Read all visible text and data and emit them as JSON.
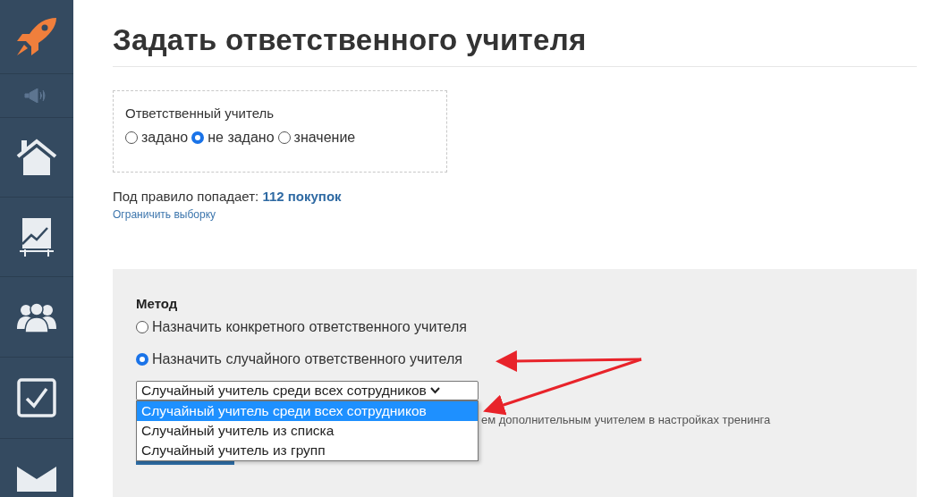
{
  "title": "Задать ответственного учителя",
  "filter": {
    "label": "Ответственный учитель",
    "options": [
      {
        "label": "задано",
        "selected": false
      },
      {
        "label": "не задано",
        "selected": true
      },
      {
        "label": "значение",
        "selected": false
      }
    ]
  },
  "match": {
    "prefix": "Под правило попадает:",
    "count": "112 покупок"
  },
  "limit_link": "Ограничить выборку",
  "method": {
    "heading": "Метод",
    "options": [
      {
        "label": "Назначить конкретного ответственного учителя",
        "selected": false
      },
      {
        "label": "Назначить случайного ответственного учителя",
        "selected": true
      }
    ],
    "select": {
      "value": "Случайный учитель среди всех сотрудников",
      "open": true,
      "options": [
        {
          "label": "Случайный учитель среди всех сотрудников",
          "selected": true
        },
        {
          "label": "Случайный учитель из списка",
          "selected": false
        },
        {
          "label": "Случайный учитель из групп",
          "selected": false
        }
      ]
    },
    "note": "ем дополнительным учителем в настройках тренинга"
  }
}
